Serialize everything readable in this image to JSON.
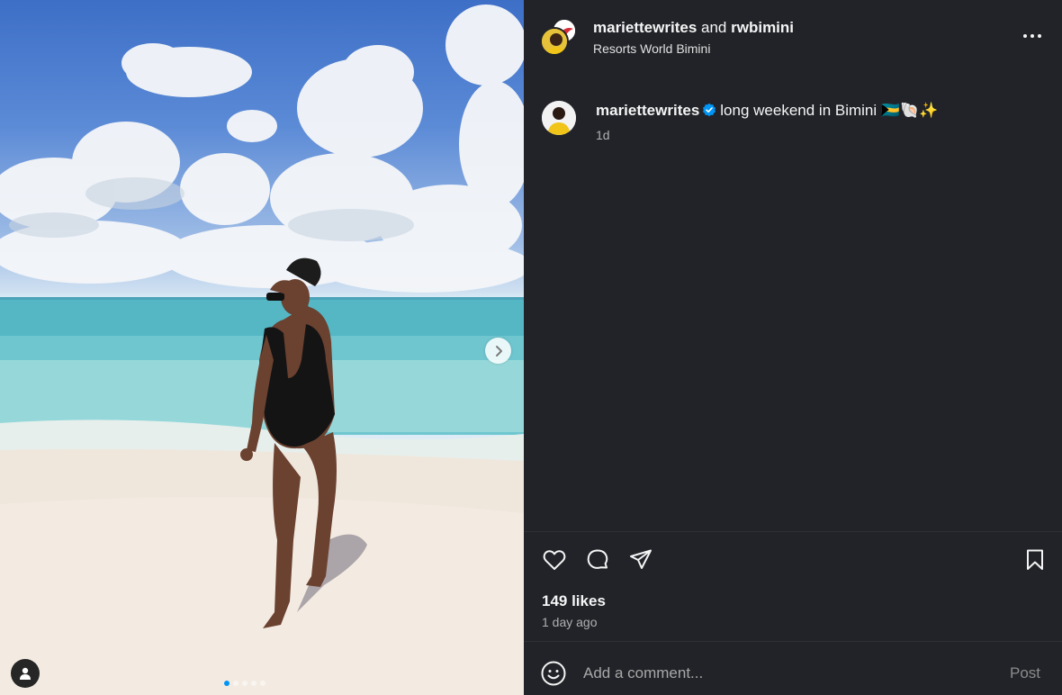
{
  "header": {
    "user1": "mariettewrites",
    "joiner": "and",
    "user2": "rwbimini",
    "location": "Resorts World Bimini"
  },
  "caption": {
    "username": "mariettewrites",
    "text": "long weekend in Bimini",
    "emojis": "🇧🇸🐚✨",
    "time": "1d"
  },
  "stats": {
    "likes": "149 likes",
    "posted_ago": "1 day ago"
  },
  "comment": {
    "placeholder": "Add a comment...",
    "post_label": "Post"
  },
  "carousel": {
    "slide_count": 5,
    "active_index": 0
  },
  "icons": {
    "more": "more-options-icon",
    "verified": "verified-badge-icon",
    "like": "heart-icon",
    "comment": "comment-bubble-icon",
    "share": "send-icon",
    "save": "bookmark-icon",
    "emoji": "smiley-icon",
    "next": "chevron-right-icon",
    "tag": "person-tag-icon"
  },
  "colors": {
    "panel_bg": "#212328",
    "verified": "#0095f6",
    "muted_text": "#b0b0b0"
  }
}
